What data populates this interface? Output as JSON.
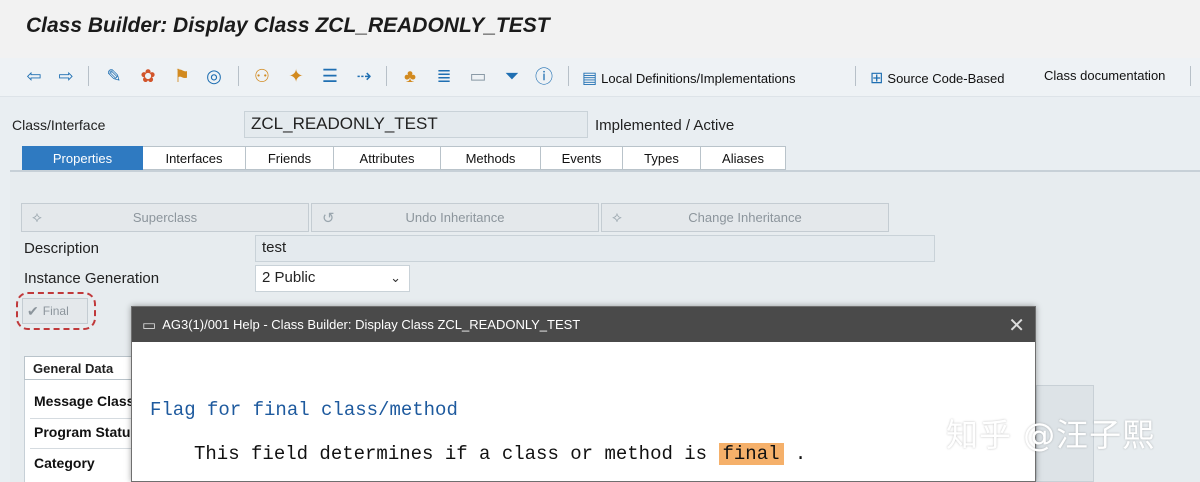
{
  "window": {
    "title": "Class Builder: Display Class ZCL_READONLY_TEST"
  },
  "toolbar": {
    "local_defs": "Local Definitions/Implementations",
    "source_code": "Source Code-Based",
    "class_doc": "Class documentation",
    "icons": [
      "back-icon",
      "forward-icon",
      "other-object-icon",
      "display-change-icon",
      "activate-icon",
      "where-used-icon",
      "hierarchy-icon",
      "pattern-icon",
      "fold-icon",
      "export-icon",
      "tree-icon",
      "align-icon",
      "frame-icon",
      "filter-icon",
      "info-icon",
      "local-defs-icon",
      "source-code-icon"
    ]
  },
  "header": {
    "class_label": "Class/Interface",
    "class_value": "ZCL_READONLY_TEST",
    "status": "Implemented / Active"
  },
  "tabs": [
    "Properties",
    "Interfaces",
    "Friends",
    "Attributes",
    "Methods",
    "Events",
    "Types",
    "Aliases"
  ],
  "buttons": {
    "superclass": "Superclass",
    "undo_inheritance": "Undo Inheritance",
    "change_inheritance": "Change Inheritance"
  },
  "form": {
    "description_label": "Description",
    "description_value": "test",
    "instance_label": "Instance Generation",
    "instance_value": "2 Public",
    "final_label": "Final"
  },
  "general": {
    "tab": "General Data",
    "rows": [
      "Message Class",
      "Program Status",
      "Category"
    ]
  },
  "dialog": {
    "title": "AG3(1)/001 Help - Class Builder: Display Class ZCL_READONLY_TEST",
    "heading": "Flag for final class/method",
    "body_prefix": "This field determines if a class or method is ",
    "body_highlight": "final",
    "body_suffix": " ."
  },
  "watermark": "知乎 @汪子熙",
  "colors": {
    "accent": "#2f7ac1",
    "highlight": "#f5b06a",
    "annotation": "#c0393b"
  }
}
